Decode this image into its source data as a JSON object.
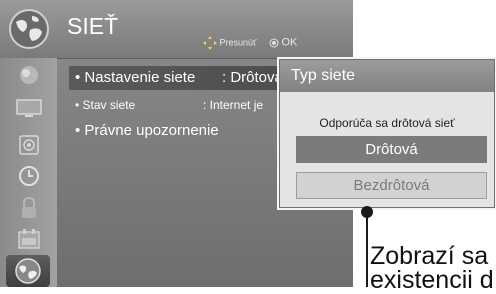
{
  "header": {
    "title": "SIEŤ",
    "hint_move_label": "Presunúť",
    "hint_ok_label": "OK"
  },
  "sidebar": {
    "icons": [
      "picture-icon",
      "tv-icon",
      "audio-icon",
      "clock-icon",
      "lock-icon",
      "calendar-icon",
      "network-icon"
    ],
    "active_icon": "network-icon"
  },
  "menu": {
    "items": [
      {
        "label": "• Nastavenie siete",
        "value": ": Drôtová"
      },
      {
        "label": "• Stav siete",
        "value": ": Internet je"
      },
      {
        "label": "• Právne upozornenie",
        "value": ""
      }
    ]
  },
  "popup": {
    "title": "Typ siete",
    "message": "Odporúča sa drôtová sieť",
    "options": [
      {
        "label": "Drôtová",
        "selected": true
      },
      {
        "label": "Bezdrôtová",
        "selected": false
      }
    ]
  },
  "callout": {
    "line1": "Zobrazí sa",
    "line2": "existencii d"
  },
  "colors": {
    "panel": "#7e7e7e",
    "popup_bg": "#e4e4e4",
    "selected_option": "#7b7b7b"
  }
}
